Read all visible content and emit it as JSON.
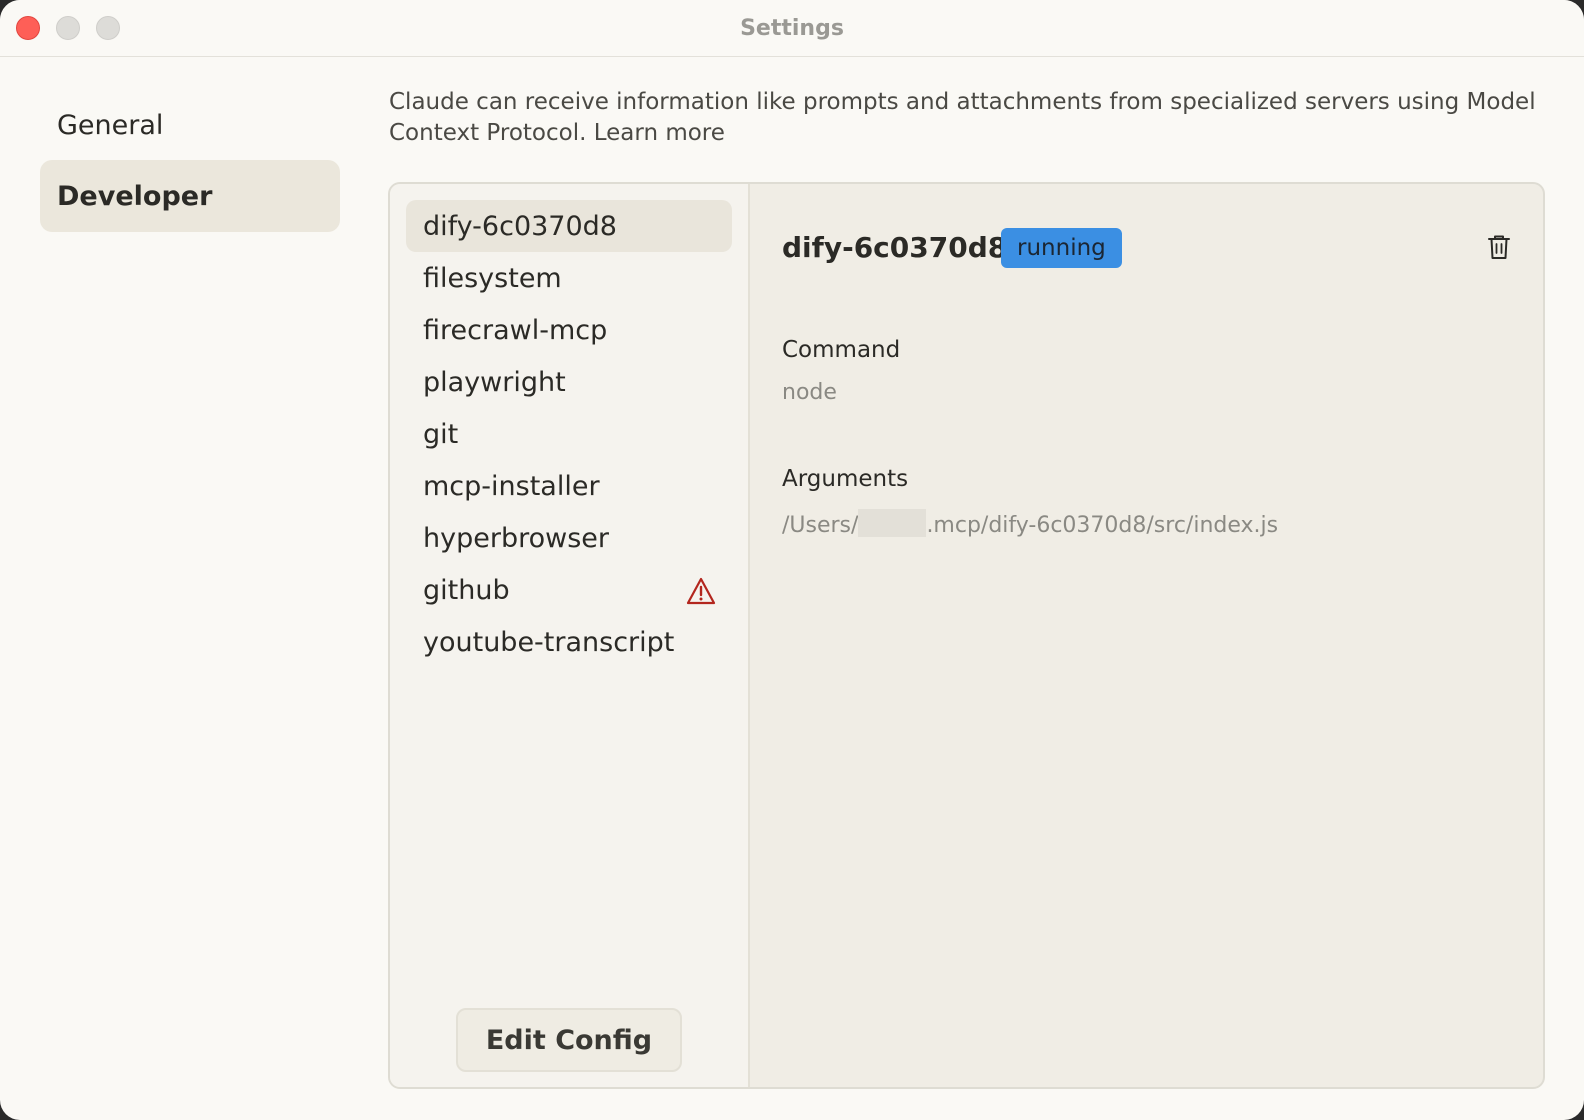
{
  "window": {
    "title": "Settings"
  },
  "nav": {
    "items": [
      {
        "label": "General"
      },
      {
        "label": "Developer"
      }
    ]
  },
  "intro": {
    "text": "Claude can receive information like prompts and attachments from specialized servers using Model Context Protocol. ",
    "link": "Learn more"
  },
  "servers": [
    {
      "name": "dify-6c0370d8",
      "selected": true
    },
    {
      "name": "filesystem"
    },
    {
      "name": "firecrawl-mcp"
    },
    {
      "name": "playwright"
    },
    {
      "name": "git"
    },
    {
      "name": "mcp-installer"
    },
    {
      "name": "hyperbrowser"
    },
    {
      "name": "github",
      "warning": true,
      "icon": "warning-icon"
    },
    {
      "name": "youtube-transcript"
    }
  ],
  "edit_config_label": "Edit Config",
  "detail": {
    "name": "dify-6c0370d8",
    "status": "running",
    "status_color": "#3b8fe3",
    "command_label": "Command",
    "command_value": "node",
    "arguments_label": "Arguments",
    "arguments_prefix": "/Users/",
    "arguments_suffix": ".mcp/dify-6c0370d8/src/index.js",
    "delete_icon": "trash-icon"
  },
  "colors": {
    "warning": "#b3261e",
    "close_button": "#fe5f57"
  }
}
